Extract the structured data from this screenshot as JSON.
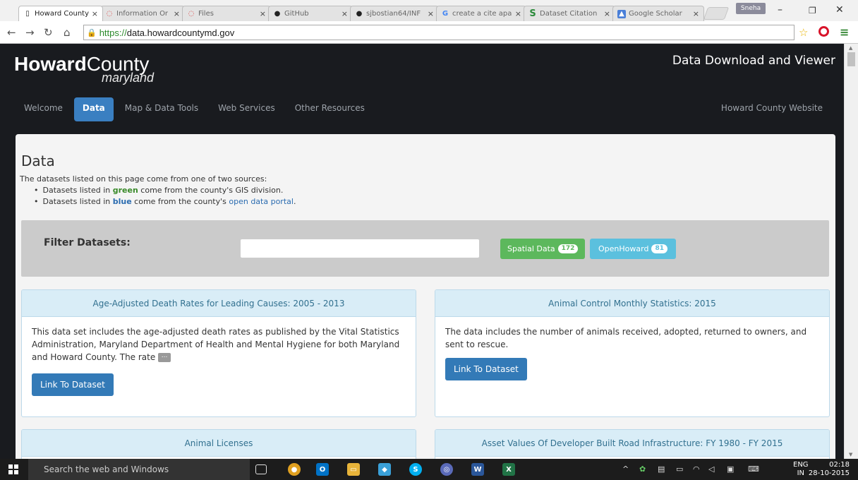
{
  "browser": {
    "tabs": [
      {
        "label": "Howard County",
        "icon": "page-icon",
        "active": true
      },
      {
        "label": "Information Or",
        "icon": "loading-icon",
        "active": false
      },
      {
        "label": "Files",
        "icon": "loading-icon",
        "active": false
      },
      {
        "label": "GitHub",
        "icon": "github-icon",
        "active": false
      },
      {
        "label": "sjbostian64/INF",
        "icon": "github-icon",
        "active": false
      },
      {
        "label": "create a cite apa",
        "icon": "google-icon",
        "active": false
      },
      {
        "label": "Dataset Citation",
        "icon": "s-icon",
        "active": false
      },
      {
        "label": "Google Scholar",
        "icon": "scholar-icon",
        "active": false
      }
    ],
    "profile_name": "Sneha",
    "url_scheme": "https://",
    "url_host": "data.howardcountymd.gov"
  },
  "site": {
    "logo_main_bold": "Howard",
    "logo_main": "County",
    "logo_sub": "maryland",
    "title": "Data Download and Viewer",
    "nav": [
      {
        "label": "Welcome",
        "active": false
      },
      {
        "label": "Data",
        "active": true
      },
      {
        "label": "Map & Data Tools",
        "active": false
      },
      {
        "label": "Web Services",
        "active": false
      },
      {
        "label": "Other Resources",
        "active": false
      }
    ],
    "nav_right": "Howard County Website"
  },
  "main": {
    "heading": "Data",
    "intro": "The datasets listed on this page come from one of two sources:",
    "bullet1_pre": "Datasets listed in ",
    "bullet1_color": "green",
    "bullet1_post": " come from the county's GIS division.",
    "bullet2_pre": "Datasets listed in ",
    "bullet2_color": "blue",
    "bullet2_mid": " come from the county's ",
    "bullet2_link": "open data portal",
    "bullet2_post": ".",
    "filter_label": "Filter Datasets:",
    "filter_placeholder": "",
    "spatial_label": "Spatial Data",
    "spatial_count": "172",
    "open_label": "OpenHoward",
    "open_count": "81"
  },
  "datasets": [
    {
      "title": "Age-Adjusted Death Rates for Leading Causes: 2005 - 2013",
      "description": "This data set includes the age-adjusted death rates as published by the Vital Statistics Administration, Maryland Department of Health and Mental Hygiene for both Maryland and Howard County. The rate",
      "more": "...",
      "button": "Link To Dataset"
    },
    {
      "title": "Animal Control Monthly Statistics: 2015",
      "description": "The data includes the number of animals received, adopted, returned to owners, and sent to rescue.",
      "button": "Link To Dataset"
    },
    {
      "title": "Animal Licenses"
    },
    {
      "title": "Asset Values Of Developer Built Road Infrastructure: FY 1980 - FY 2015"
    }
  ],
  "taskbar": {
    "search_placeholder": "Search the web and Windows",
    "lang_top": "ENG",
    "lang_bottom": "IN",
    "time": "02:18",
    "date": "28-10-2015"
  },
  "colors": {
    "spatial": "#5cb85c",
    "open": "#5bc0de",
    "nav_active": "#3a7fc1",
    "card_head": "#d9edf7"
  }
}
